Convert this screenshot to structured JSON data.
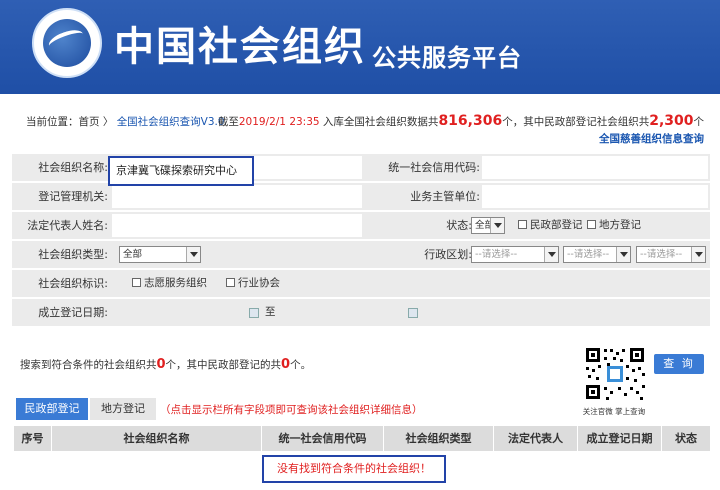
{
  "header": {
    "title": "中国社会组织",
    "subtitle": "公共服务平台"
  },
  "breadcrumb": {
    "prefix": "当前位置：",
    "home": "首页",
    "sep": "〉",
    "current": "全国社会组织查询V3.0"
  },
  "stats": {
    "t1": "截至",
    "date": "2019/2/1 23:35",
    "t2": " 入库全国社会组织数据共",
    "total": "816,306",
    "t3": "个，其中民政部登记社会组织共",
    "ministry": "2,300",
    "t4": "个",
    "charity_link": "全国慈善组织信息查询"
  },
  "form": {
    "org_name_label": "社会组织名称:",
    "org_name_value": "京津冀飞碟探索研究中心",
    "credit_code_label": "统一社会信用代码:",
    "reg_authority_label": "登记管理机关:",
    "supervisor_label": "业务主管单位:",
    "legal_rep_label": "法定代表人姓名:",
    "status_label": "状态:",
    "status_value": "全部",
    "ministry_reg": "民政部登记",
    "local_reg": "地方登记",
    "org_type_label": "社会组织类型:",
    "org_type_value": "全部",
    "region_label": "行政区划:",
    "region_placeholder": "--请选择--",
    "org_mark_label": "社会组织标识:",
    "volunteer": "志愿服务组织",
    "industry": "行业协会",
    "found_date_label": "成立登记日期:",
    "to": "至"
  },
  "result": {
    "t1": "搜索到符合条件的社会组织共",
    "count": "0",
    "t2": "个，其中民政部登记的共",
    "ministry_count": "0",
    "t3": "个。"
  },
  "qr_caption": "关注官微 掌上查询",
  "query_button": "查 询",
  "tabs": {
    "ministry": "民政部登记",
    "local": "地方登记",
    "note": "（点击显示栏所有字段项即可查询该社会组织详细信息）"
  },
  "table": {
    "headers": [
      "序号",
      "社会组织名称",
      "统一社会信用代码",
      "社会组织类型",
      "法定代表人",
      "成立登记日期",
      "状态"
    ],
    "empty_message": "没有找到符合条件的社会组织！"
  }
}
